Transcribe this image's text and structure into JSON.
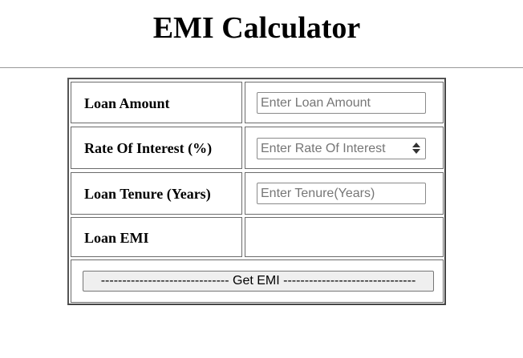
{
  "page": {
    "title": "EMI Calculator"
  },
  "form": {
    "loan_amount": {
      "label": "Loan Amount",
      "value": "",
      "placeholder": "Enter Loan Amount"
    },
    "rate_of_interest": {
      "label": "Rate Of Interest (%)",
      "value": "",
      "placeholder": "Enter Rate Of Interest"
    },
    "loan_tenure": {
      "label": "Loan Tenure (Years)",
      "value": "",
      "placeholder": "Enter Tenure(Years)"
    },
    "loan_emi": {
      "label": "Loan EMI",
      "value": ""
    },
    "submit": {
      "label": "------------------------------  Get EMI  -------------------------------"
    }
  },
  "icons": {
    "number_spinner": "up-down-spinner-icon"
  },
  "colors": {
    "border": "#555555",
    "button_bg": "#efefef",
    "placeholder": "#767676"
  }
}
